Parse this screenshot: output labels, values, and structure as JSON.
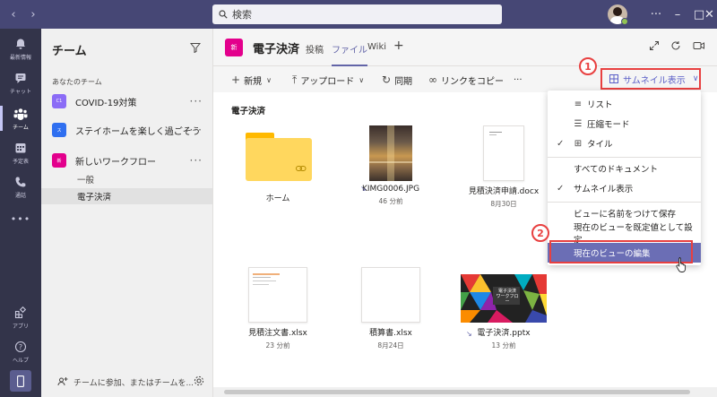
{
  "titlebar": {
    "search_placeholder": "検索"
  },
  "rail": {
    "items": [
      {
        "label": "最新情報",
        "icon": "bell-icon"
      },
      {
        "label": "チャット",
        "icon": "chat-icon"
      },
      {
        "label": "チーム",
        "icon": "teams-icon"
      },
      {
        "label": "予定表",
        "icon": "calendar-icon"
      },
      {
        "label": "通話",
        "icon": "phone-icon"
      },
      {
        "label": "•••",
        "icon": "more-icon"
      },
      {
        "label": "アプリ",
        "icon": "apps-icon"
      },
      {
        "label": "ヘルプ",
        "icon": "help-icon"
      }
    ]
  },
  "teams_pane": {
    "title": "チーム",
    "section_label": "あなたのチーム",
    "teams": [
      {
        "tile": "C1",
        "name": "COVID-19対策",
        "color": "#8b6cf6"
      },
      {
        "tile": "ス",
        "name": "ステイホームを楽しく過ごそう",
        "color": "#2f6ff0"
      },
      {
        "tile": "新",
        "name": "新しいワークフロー",
        "color": "#e3008c"
      }
    ],
    "channels": [
      {
        "name": "一般"
      },
      {
        "name": "電子決済"
      }
    ],
    "footer_label": "チームに参加、またはチームを..."
  },
  "header": {
    "tile": "新",
    "title": "電子決済",
    "tabs": [
      "投稿",
      "ファイル",
      "Wiki"
    ],
    "add_tab": "+"
  },
  "toolbar": {
    "new_label": "新規",
    "upload_label": "アップロード",
    "sync_label": "同期",
    "copy_link_label": "リンクをコピー",
    "more_label": "···",
    "view_label": "サムネイル表示"
  },
  "library": {
    "title": "電子決済",
    "files": [
      {
        "name": "ホーム",
        "date": ""
      },
      {
        "name": "KIMG0006.JPG",
        "date": "46 分前"
      },
      {
        "name": "見積決済申請.docx",
        "date": "8月30日"
      },
      {
        "name": "見積注文書.xlsx",
        "date": "23 分前"
      },
      {
        "name": "積算書.xlsx",
        "date": "8月24日"
      },
      {
        "name": "電子決済.pptx",
        "date": "13 分前"
      }
    ],
    "pptx_thumb_title": "電子決済",
    "pptx_thumb_sub": "ワークフロー"
  },
  "view_menu": {
    "items": [
      {
        "label": "リスト",
        "icon": "list-icon",
        "checked": false
      },
      {
        "label": "圧縮モード",
        "icon": "compact-icon",
        "checked": false
      },
      {
        "label": "タイル",
        "icon": "tile-icon",
        "checked": true
      },
      {
        "label": "すべてのドキュメント",
        "checked": false
      },
      {
        "label": "サムネイル表示",
        "checked": true
      },
      {
        "label": "ビューに名前をつけて保存",
        "checked": false
      },
      {
        "label": "現在のビューを既定値として設定",
        "checked": false
      },
      {
        "label": "現在のビューの編集",
        "checked": false,
        "highlighted": true
      }
    ]
  },
  "callouts": [
    "1",
    "2"
  ],
  "colors": {
    "brand": "#6264a7",
    "titlebar": "#464775",
    "rail": "#33344a",
    "callout": "#e84040"
  }
}
